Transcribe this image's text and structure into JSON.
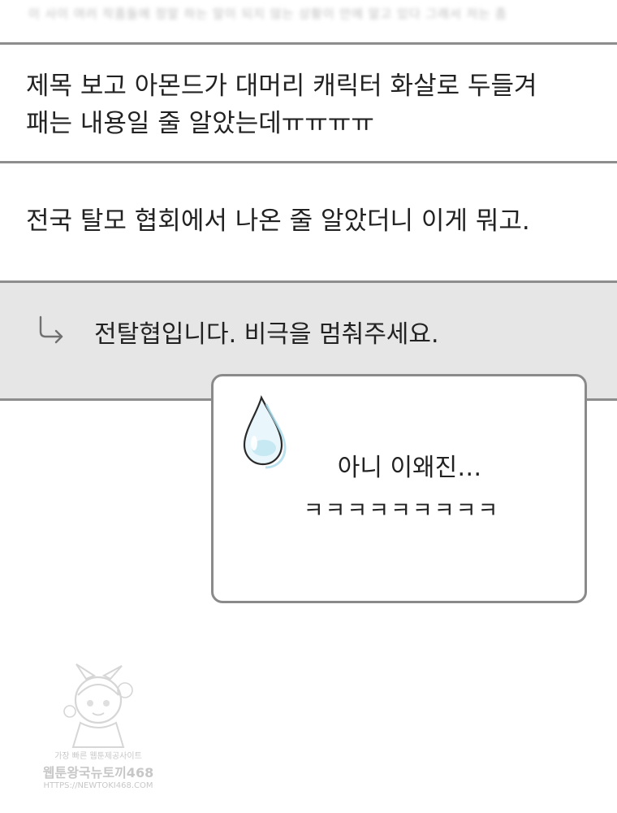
{
  "previous_comment_fragment": "이 사이 여러 작품들에 정말 하는 말이 되지 않는 상황이 안에 알고 있다 그래서 저는 좀",
  "comments": [
    {
      "lines": [
        "제목 보고 아몬드가 대머리 캐릭터 화살로 두들겨",
        "패는 내용일 줄 알았는데ㅠㅠㅠㅠ"
      ]
    },
    {
      "lines": [
        "전국 탈모 협회에서 나온 줄 알았더니 이게 뭐고."
      ]
    }
  ],
  "reply": {
    "icon": "reply-arrow-icon",
    "text": "전탈협입니다. 비극을 멈춰주세요."
  },
  "speech_bubble": {
    "icon": "sweat-drop-icon",
    "line1": "아니 이왜진…",
    "line2": "ㅋㅋㅋㅋㅋㅋㅋㅋㅋ"
  },
  "watermark": {
    "line1": "가장 빠른 웹툰제공사이트",
    "line2": "웹툰왕국뉴토끼468",
    "line3": "HTTPS://NEWTOKI468.COM"
  },
  "colors": {
    "divider": "#8d8d8d",
    "reply_background": "#e6e6e6",
    "bubble_border": "#8a8a8a",
    "drop_tint": "#a9d9ea",
    "text": "#222222"
  }
}
